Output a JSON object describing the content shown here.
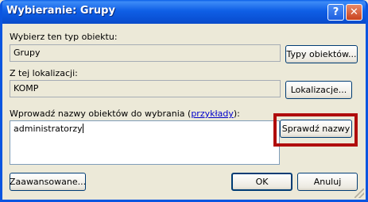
{
  "window": {
    "title": "Wybieranie: Grupy",
    "help_glyph": "?",
    "close_glyph": "✕"
  },
  "object_type": {
    "label": "Wybierz ten typ obiektu:",
    "value": "Grupy",
    "button": "Typy obiektów..."
  },
  "location": {
    "label": "Z tej lokalizacji:",
    "value": "KOMP",
    "button": "Lokalizacje..."
  },
  "names": {
    "label_prefix": "Wprowadź nazwy obiektów do wybrania (",
    "label_link": "przykłady",
    "label_suffix": "):",
    "value": "administratorzy",
    "check_button": "Sprawdź nazwy"
  },
  "footer": {
    "advanced_button": "Zaawansowane...",
    "ok_button": "OK",
    "cancel_button": "Anuluj"
  },
  "colors": {
    "title_bar": "#0a5fe8",
    "highlight": "#b00d0d",
    "dialog_bg": "#ece9d8"
  }
}
